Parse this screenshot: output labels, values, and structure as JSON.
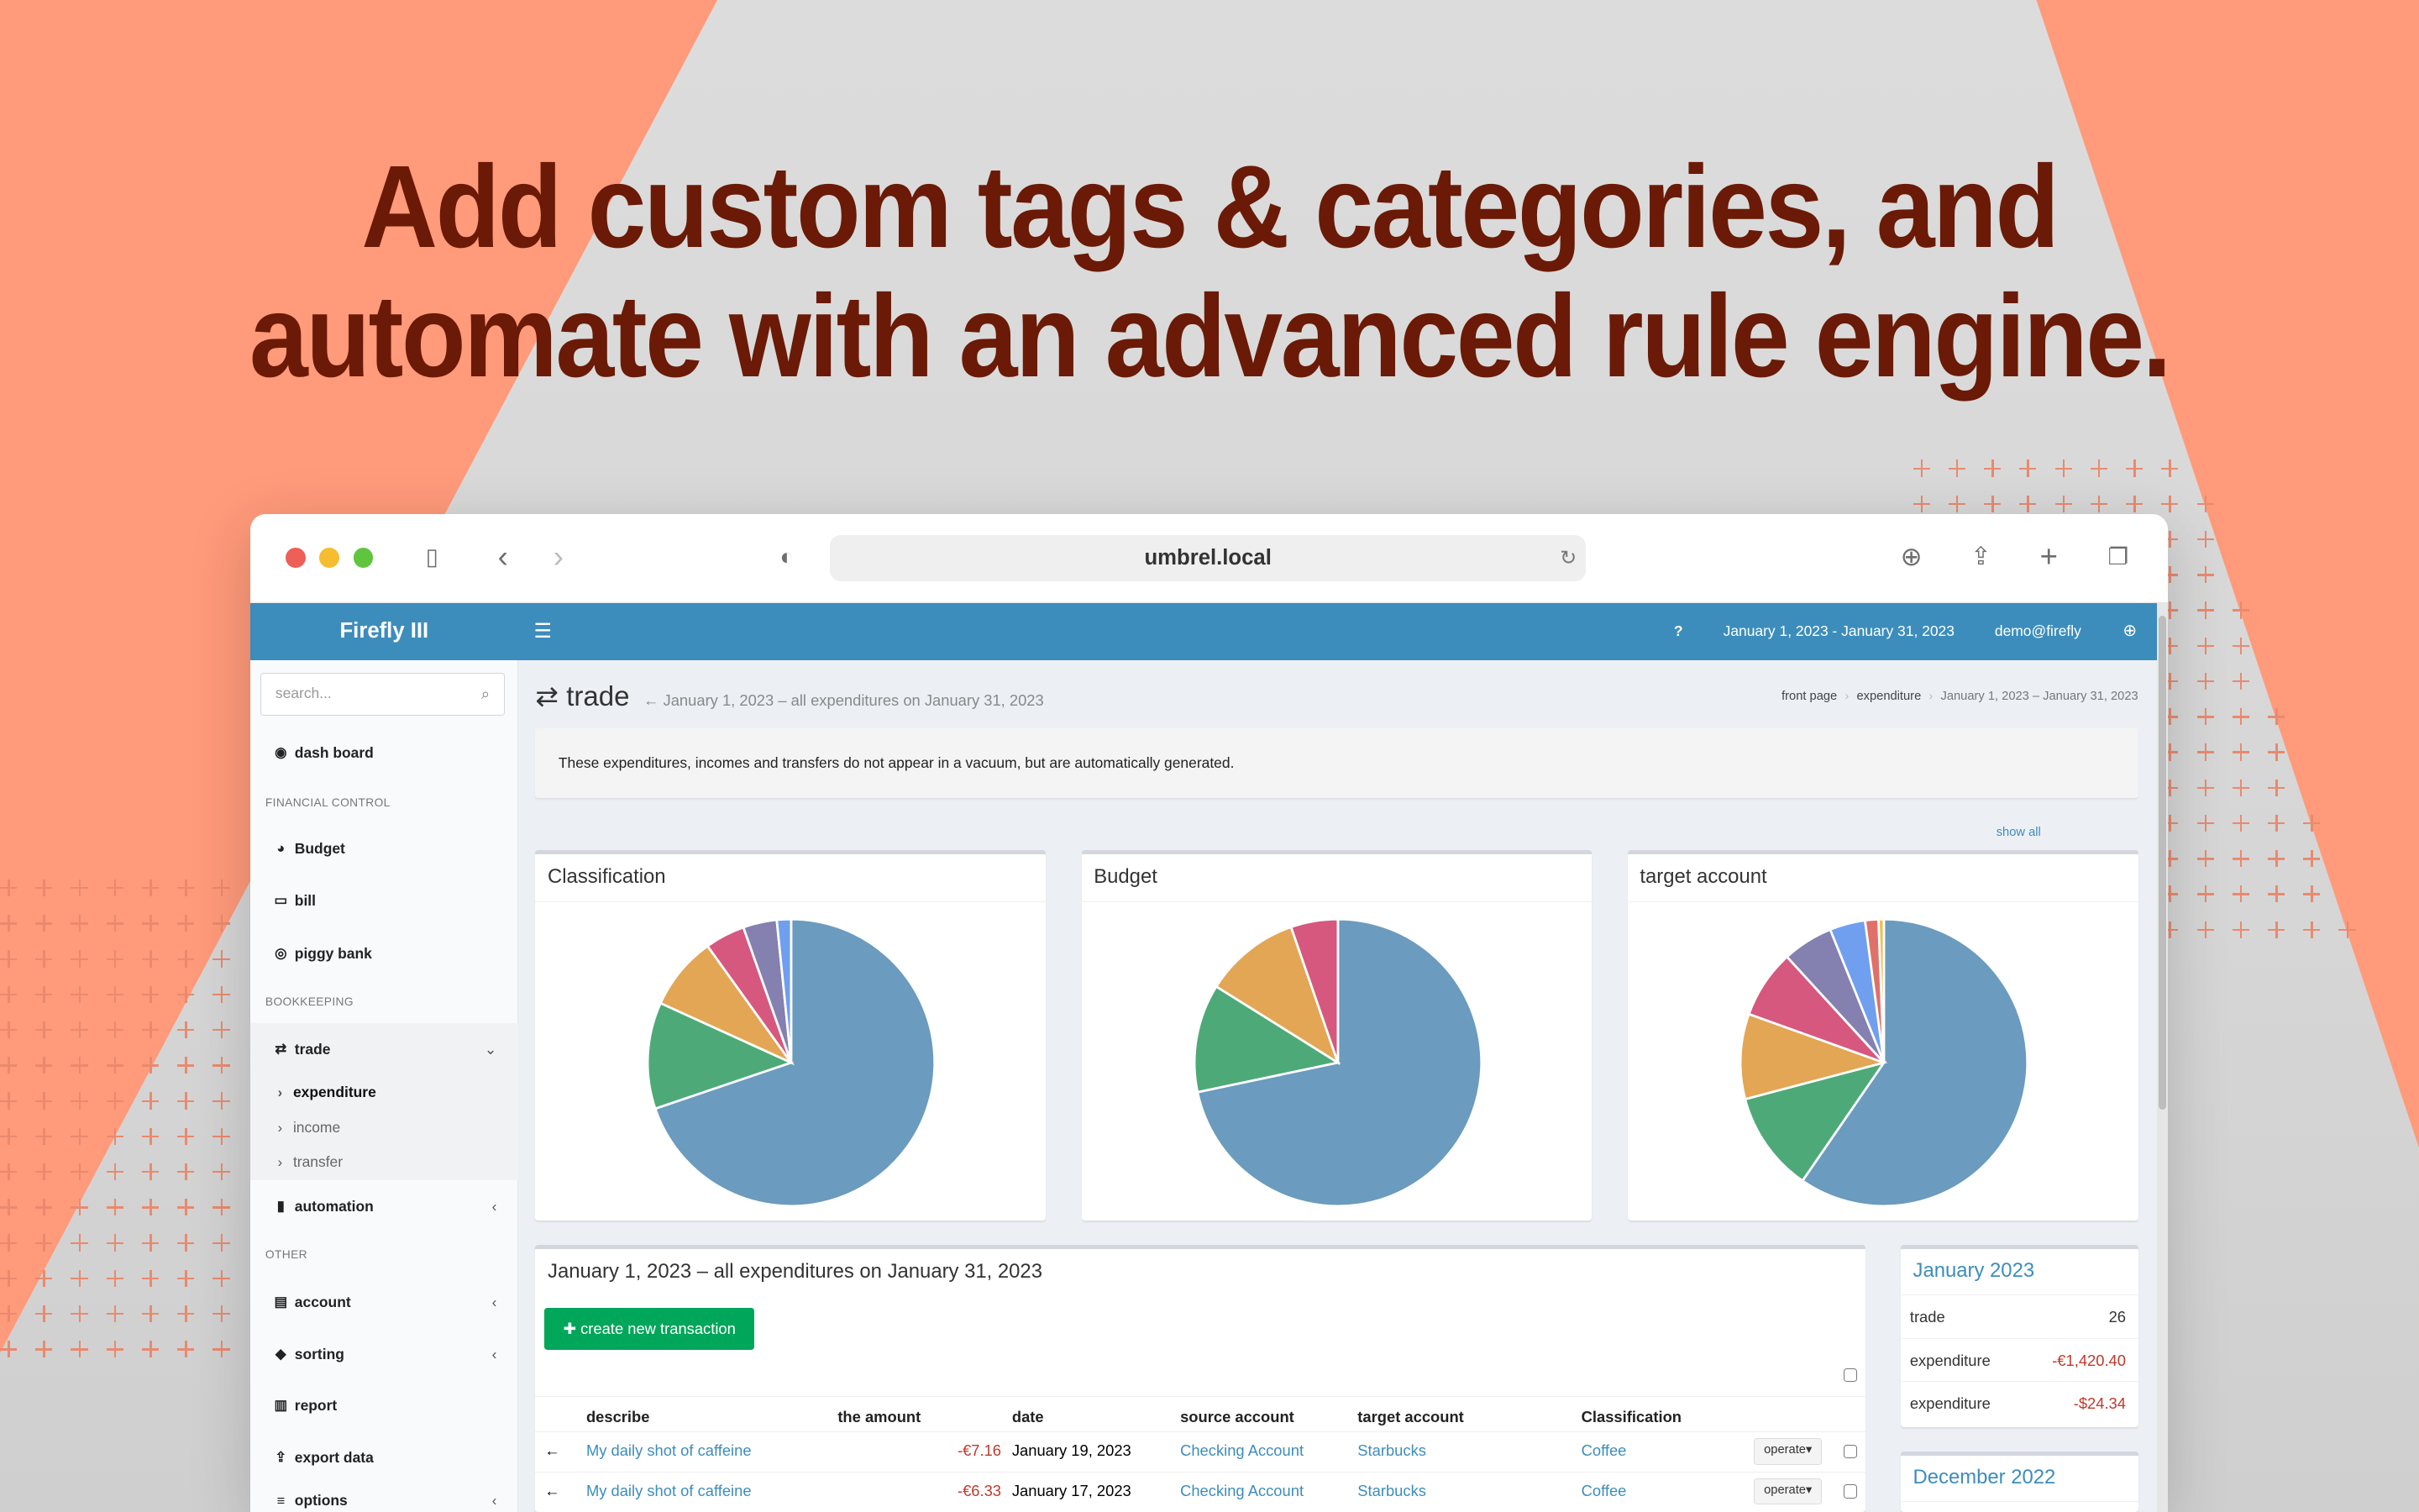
{
  "headline": {
    "line1": "Add custom tags & categories, and",
    "line2": "automate with an advanced rule engine."
  },
  "browser": {
    "url": "umbrel.local",
    "icons": [
      "sidebar-icon",
      "back-icon",
      "forward-icon",
      "shield-icon",
      "reload-icon",
      "download-icon",
      "share-icon",
      "new-tab-icon",
      "tabs-icon"
    ]
  },
  "app": {
    "brand": "Firefly III",
    "header": {
      "date_range": "January 1, 2023 - January 31, 2023",
      "user": "demo@firefly",
      "color": "#3c8dbc"
    },
    "sidebar": {
      "search_placeholder": "search...",
      "dashboard": "dash board",
      "section_financial": "FINANCIAL CONTROL",
      "budget": "Budget",
      "bill": "bill",
      "piggy_bank": "piggy bank",
      "section_bookkeeping": "BOOKKEEPING",
      "trade": "trade",
      "expenditure": "expenditure",
      "income": "income",
      "transfer": "transfer",
      "automation": "automation",
      "section_other": "OTHER",
      "account": "account",
      "sorting": "sorting",
      "report": "report",
      "export_data": "export data",
      "options": "options"
    },
    "page": {
      "title": "trade",
      "subtitle": "January 1, 2023 – all expenditures on January 31, 2023",
      "breadcrumb": [
        "front page",
        "expenditure",
        "January 1, 2023 – January 31, 2023"
      ],
      "callout": "These expenditures, incomes and transfers do not appear in a vacuum, but are automatically generated.",
      "show_all": "show all"
    },
    "transactions": {
      "title": "January 1, 2023 – all expenditures on January 31, 2023",
      "create_button": "create new transaction",
      "columns": [
        "describe",
        "the amount",
        "date",
        "source account",
        "target account",
        "Classification"
      ],
      "rows": [
        {
          "description": "My daily shot of caffeine",
          "amount": "-€7.16",
          "date": "January 19, 2023",
          "source": "Checking Account",
          "target": "Starbucks",
          "category": "Coffee",
          "action": "operate"
        },
        {
          "description": "My daily shot of caffeine",
          "amount": "-€6.33",
          "date": "January 17, 2023",
          "source": "Checking Account",
          "target": "Starbucks",
          "category": "Coffee",
          "action": "operate"
        }
      ]
    },
    "summary": [
      {
        "title": "January 2023",
        "rows": [
          {
            "label": "trade",
            "value": "26"
          },
          {
            "label": "expenditure",
            "value": "-€1,420.40"
          },
          {
            "label": "expenditure",
            "value": "-$24.34"
          }
        ]
      },
      {
        "title": "December 2022",
        "rows": []
      }
    ]
  },
  "chart_data": [
    {
      "type": "pie",
      "title": "Classification",
      "values": [
        69.8,
        12.0,
        8.3,
        4.5,
        3.8,
        1.6
      ],
      "colors": [
        "#6b9bbe",
        "#4daa78",
        "#e3a655",
        "#d6587f",
        "#8480b0",
        "#6f9fee"
      ]
    },
    {
      "type": "pie",
      "title": "Budget",
      "values": [
        71.7,
        12.2,
        10.8,
        5.3
      ],
      "colors": [
        "#6b9bbe",
        "#4daa78",
        "#e3a655",
        "#d6587f"
      ]
    },
    {
      "type": "pie",
      "title": "target account",
      "values": [
        59.6,
        11.3,
        9.6,
        7.7,
        5.7,
        4.0,
        1.5,
        0.6
      ],
      "colors": [
        "#6b9bbe",
        "#4daa78",
        "#e3a655",
        "#d6587f",
        "#8480b0",
        "#6f9fee",
        "#e0706a",
        "#f0c04c"
      ]
    }
  ]
}
